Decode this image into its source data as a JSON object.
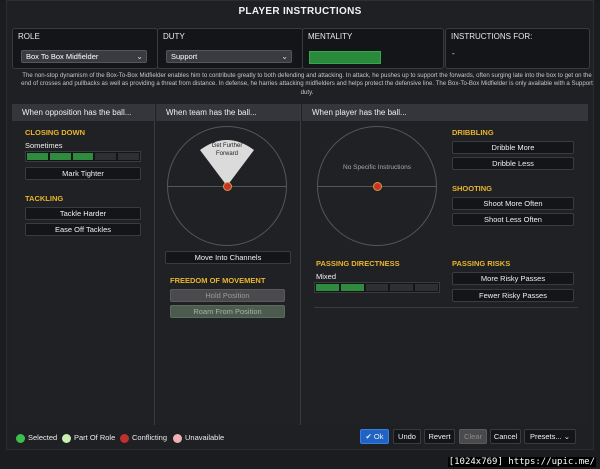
{
  "title": "PLAYER INSTRUCTIONS",
  "role": {
    "label": "ROLE",
    "value": "Box To Box Midfielder"
  },
  "duty": {
    "label": "DUTY",
    "value": "Support"
  },
  "mentality": {
    "label": "MENTALITY",
    "level": 0.6,
    "color": "#2a8a3c"
  },
  "instructions_for": {
    "label": "INSTRUCTIONS FOR:",
    "value": "-"
  },
  "description": "The non-stop dynamism of the Box-To-Box Midfielder enables him to contribute greatly to both defending and attacking. In attack, he pushes up to support the forwards, often surging late into the box to get on the end of crosses and pullbacks as well as providing a threat from distance. In defense, he harries attacking midfielders and helps protect the defensive line. The Box-To-Box Midfielder is only available with a Support duty.",
  "opposition": {
    "header": "When opposition has the ball...",
    "closing_down_title": "CLOSING DOWN",
    "closing_down_value": "Sometimes",
    "closing_down_level": 3,
    "closing_down_segments": 5,
    "mark_tighter": "Mark Tighter",
    "tackling_title": "TACKLING",
    "tackle_harder": "Tackle Harder",
    "ease_off": "Ease Off Tackles"
  },
  "team_ball": {
    "header": "When team has the ball...",
    "cone_label": "Get Further Forward",
    "move_channels": "Move Into Channels",
    "freedom_title": "FREEDOM OF MOVEMENT",
    "hold_position": "Hold Position",
    "roam": "Roam From Position"
  },
  "player_ball": {
    "header": "When player has the ball...",
    "no_specific": "No Specific Instructions",
    "dribbling_title": "DRIBBLING",
    "dribble_more": "Dribble More",
    "dribble_less": "Dribble Less",
    "shooting_title": "SHOOTING",
    "shoot_more": "Shoot More Often",
    "shoot_less": "Shoot Less Often",
    "passing_dir_title": "PASSING DIRECTNESS",
    "passing_dir_value": "Mixed",
    "passing_dir_level": 2,
    "passing_dir_segments": 5,
    "passing_risks_title": "PASSING RISKS",
    "more_risky": "More Risky Passes",
    "fewer_risky": "Fewer Risky Passes"
  },
  "legend": {
    "selected": "Selected",
    "selected_color": "#3cbf4a",
    "part_of_role": "Part Of Role",
    "part_color": "#c9f0b0",
    "conflicting": "Conflicting",
    "conflicting_color": "#c0312b",
    "unavailable": "Unavailable",
    "unavailable_color": "#f0b0b8"
  },
  "footer_buttons": {
    "ok": "Ok",
    "undo": "Undo",
    "revert": "Revert",
    "clear": "Clear",
    "cancel": "Cancel",
    "presets": "Presets..."
  },
  "watermark": "[1024x769] https://upic.me/"
}
